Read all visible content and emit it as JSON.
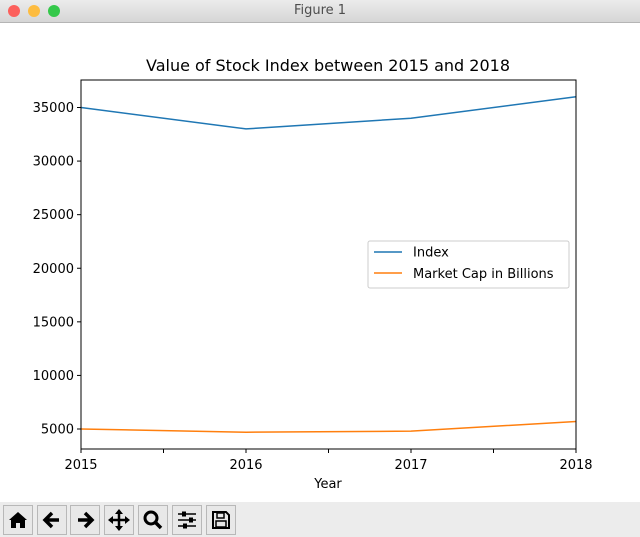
{
  "window": {
    "title": "Figure 1",
    "traffic_lights": {
      "close": "#fc605c",
      "minimize": "#fdbc40",
      "zoom": "#34c84a"
    }
  },
  "toolbar": {
    "buttons": [
      "home-icon",
      "back-arrow-icon",
      "forward-arrow-icon",
      "pan-icon",
      "zoom-magnifier-icon",
      "configure-subplots-icon",
      "save-icon"
    ]
  },
  "chart_data": {
    "type": "line",
    "title": "Value of Stock Index between 2015 and 2018",
    "xlabel": "Year",
    "ylabel": "",
    "x": [
      2015,
      2016,
      2017,
      2018
    ],
    "xlim": [
      2015,
      2018
    ],
    "ylim": [
      3135,
      37565
    ],
    "xticks": [
      "2015",
      "2016",
      "2017",
      "2018"
    ],
    "yticks": [
      "5000",
      "10000",
      "15000",
      "20000",
      "25000",
      "30000",
      "35000"
    ],
    "grid": false,
    "legend": "center-right",
    "series": [
      {
        "name": "Index",
        "values": [
          35000,
          33000,
          34000,
          36000
        ],
        "color": "#1f77b4"
      },
      {
        "name": "Market Cap in Billions",
        "values": [
          5000,
          4700,
          4800,
          5700
        ],
        "color": "#ff7f0e"
      }
    ]
  }
}
